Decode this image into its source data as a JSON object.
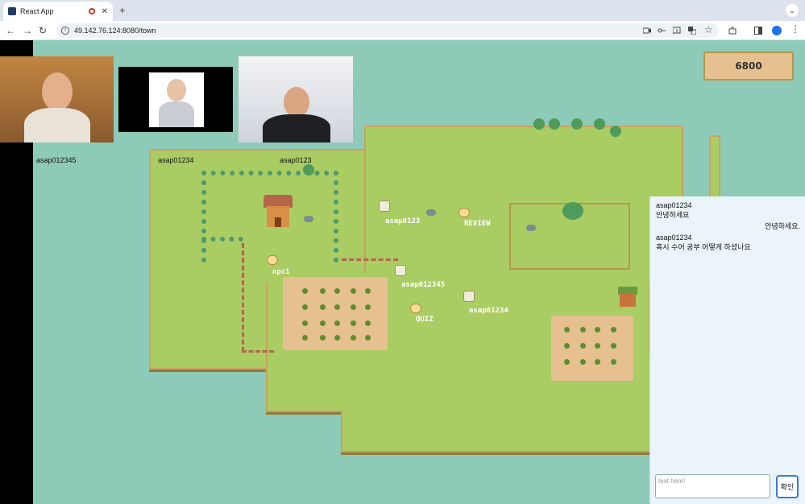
{
  "browser": {
    "tab_title": "React App",
    "url": "49.142.76.124:8080/town"
  },
  "score": {
    "value": "6800"
  },
  "cameras": [
    {
      "name": "asap012345"
    },
    {
      "name": "asap01234"
    },
    {
      "name": "asap0123"
    }
  ],
  "game": {
    "npcs": [
      {
        "label": "npc1"
      },
      {
        "label": "REVIEW"
      },
      {
        "label": "QUIZ"
      }
    ],
    "players": [
      {
        "label": "asap0123"
      },
      {
        "label": "asap012345"
      },
      {
        "label": "asap01234"
      }
    ]
  },
  "chat": {
    "messages": [
      {
        "sender": "asap01234",
        "text": "안녕하세요"
      },
      {
        "self": true,
        "text": "안녕하세요."
      },
      {
        "sender": "asap01234",
        "text": "혹시 수어 공부 어떻게 하셨나요"
      }
    ],
    "input_placeholder": "text here!",
    "send_label": "확인"
  },
  "colors": {
    "water": "#8dcbb8",
    "grass": "#a9cd62",
    "chat_bg": "#eaf4fa",
    "accent": "#3a7bd5"
  }
}
